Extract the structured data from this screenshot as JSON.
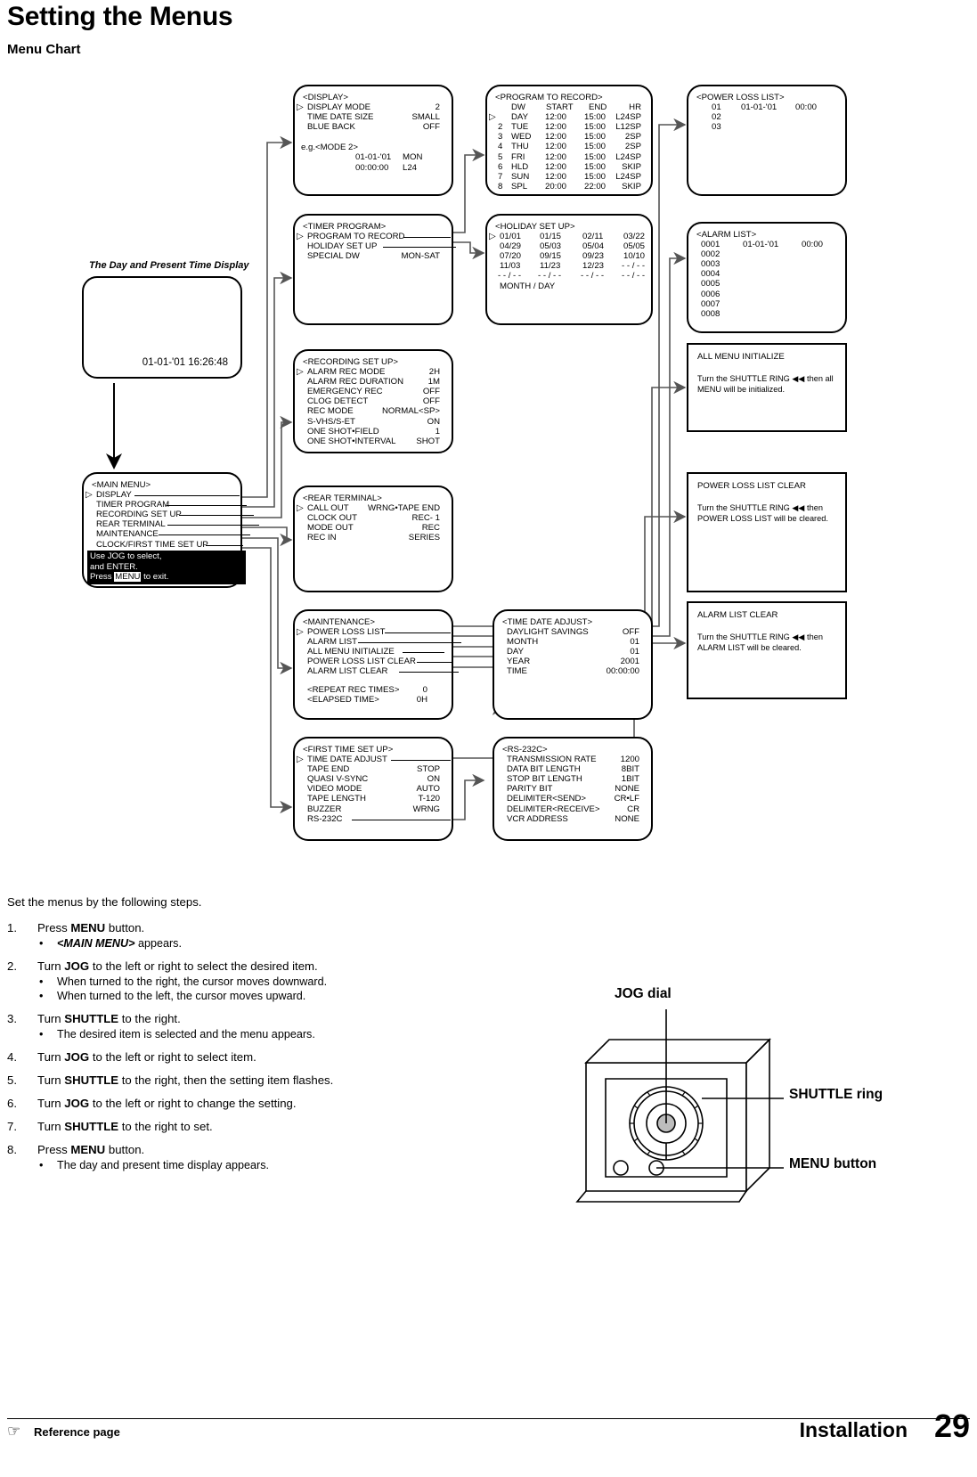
{
  "page": {
    "title": "Setting the Menus",
    "section": "Menu Chart",
    "footer_reference": "Reference page",
    "footer_section": "Installation",
    "footer_page_number": "29"
  },
  "daytime_display": {
    "caption": "The Day and Present Time Display",
    "stamp": "01-01-'01  16:26:48"
  },
  "boxes": {
    "display": {
      "title": "<DISPLAY>",
      "rows": [
        {
          "cursor": true,
          "label": "DISPLAY MODE",
          "value": "2"
        },
        {
          "cursor": false,
          "label": "TIME DATE SIZE",
          "value": "SMALL"
        },
        {
          "cursor": false,
          "label": "BLUE BACK",
          "value": "OFF"
        }
      ],
      "example_title": "e.g.<MODE 2>",
      "example_lines": [
        {
          "left": "01-01-'01",
          "right": "MON"
        },
        {
          "left": "00:00:00",
          "right": "L24"
        }
      ]
    },
    "program_to_record": {
      "title": "<PROGRAM TO RECORD>",
      "columns": [
        "DW",
        "START",
        "END",
        "HR"
      ],
      "rows": [
        {
          "no": "",
          "cursor": true,
          "dw": "DAY",
          "start": "12:00",
          "end": "15:00",
          "hr": "L24SP"
        },
        {
          "no": "2",
          "cursor": false,
          "dw": "TUE",
          "start": "12:00",
          "end": "15:00",
          "hr": "L12SP"
        },
        {
          "no": "3",
          "cursor": false,
          "dw": "WED",
          "start": "12:00",
          "end": "15:00",
          "hr": "2SP"
        },
        {
          "no": "4",
          "cursor": false,
          "dw": "THU",
          "start": "12:00",
          "end": "15:00",
          "hr": "2SP"
        },
        {
          "no": "5",
          "cursor": false,
          "dw": "FRI",
          "start": "12:00",
          "end": "15:00",
          "hr": "L24SP"
        },
        {
          "no": "6",
          "cursor": false,
          "dw": "HLD",
          "start": "12:00",
          "end": "15:00",
          "hr": "SKIP"
        },
        {
          "no": "7",
          "cursor": false,
          "dw": "SUN",
          "start": "12:00",
          "end": "15:00",
          "hr": "L24SP"
        },
        {
          "no": "8",
          "cursor": false,
          "dw": "SPL",
          "start": "20:00",
          "end": "22:00",
          "hr": "SKIP"
        }
      ]
    },
    "power_loss_list": {
      "title": "<POWER LOSS LIST>",
      "rows": [
        {
          "no": "01",
          "date": "01-01-'01",
          "time": "00:00"
        },
        {
          "no": "02",
          "date": "",
          "time": ""
        },
        {
          "no": "03",
          "date": "",
          "time": ""
        }
      ]
    },
    "timer_program": {
      "title": "<TIMER PROGRAM>",
      "rows": [
        {
          "cursor": true,
          "label": "PROGRAM TO RECORD",
          "value": "",
          "leader": true
        },
        {
          "cursor": false,
          "label": "HOLIDAY SET UP",
          "value": "",
          "leader": true
        },
        {
          "cursor": false,
          "label": "SPECIAL DW",
          "value": "MON-SAT",
          "leader": false
        }
      ]
    },
    "holiday_set_up": {
      "title": "<HOLIDAY SET UP>",
      "rows": [
        {
          "cursor": true,
          "cells": [
            "01/01",
            "01/15",
            "02/11",
            "03/22"
          ]
        },
        {
          "cursor": false,
          "cells": [
            "04/29",
            "05/03",
            "05/04",
            "05/05"
          ]
        },
        {
          "cursor": false,
          "cells": [
            "07/20",
            "09/15",
            "09/23",
            "10/10"
          ]
        },
        {
          "cursor": false,
          "cells": [
            "11/03",
            "11/23",
            "12/23",
            "- - / - -"
          ]
        },
        {
          "cursor": false,
          "cells": [
            "- - / - -",
            "- - / - -",
            "- - / - -",
            "- - / - -"
          ]
        }
      ],
      "footer": "MONTH / DAY"
    },
    "alarm_list": {
      "title": "<ALARM LIST>",
      "rows": [
        {
          "no": "0001",
          "date": "01-01-'01",
          "time": "00:00"
        },
        {
          "no": "0002",
          "date": "",
          "time": ""
        },
        {
          "no": "0003",
          "date": "",
          "time": ""
        },
        {
          "no": "0004",
          "date": "",
          "time": ""
        },
        {
          "no": "0005",
          "date": "",
          "time": ""
        },
        {
          "no": "0006",
          "date": "",
          "time": ""
        },
        {
          "no": "0007",
          "date": "",
          "time": ""
        },
        {
          "no": "0008",
          "date": "",
          "time": ""
        }
      ]
    },
    "recording_set_up": {
      "title": "<RECORDING SET UP>",
      "rows": [
        {
          "cursor": true,
          "label": "ALARM REC MODE",
          "value": "2H"
        },
        {
          "cursor": false,
          "label": "ALARM REC DURATION",
          "value": "1M"
        },
        {
          "cursor": false,
          "label": "EMERGENCY REC",
          "value": "OFF"
        },
        {
          "cursor": false,
          "label": "CLOG DETECT",
          "value": "OFF"
        },
        {
          "cursor": false,
          "label": "REC MODE",
          "value": "NORMAL<SP>"
        },
        {
          "cursor": false,
          "label": "S-VHS/S-ET",
          "value": "ON"
        },
        {
          "cursor": false,
          "label": "ONE SHOT•FIELD",
          "value": "1"
        },
        {
          "cursor": false,
          "label": "ONE SHOT•INTERVAL",
          "value": "SHOT"
        }
      ]
    },
    "all_menu_initialize": {
      "title": "ALL MENU INITIALIZE",
      "body": "Turn the SHUTTLE RING ◀◀ then all MENU will be initialized."
    },
    "main_menu": {
      "title": "<MAIN MENU>",
      "rows": [
        {
          "cursor": true,
          "label": "DISPLAY"
        },
        {
          "cursor": false,
          "label": "TIMER PROGRAM"
        },
        {
          "cursor": false,
          "label": "RECORDING SET UP"
        },
        {
          "cursor": false,
          "label": "REAR TERMINAL"
        },
        {
          "cursor": false,
          "label": "MAINTENANCE"
        },
        {
          "cursor": false,
          "label": "CLOCK/FIRST TIME SET UP"
        }
      ],
      "help_line1": "Use JOG to select,",
      "help_line2": "and ENTER.",
      "help_line3_pre": "Press ",
      "help_line3_key": "MENU",
      "help_line3_post": " to exit."
    },
    "rear_terminal": {
      "title": "<REAR TERMINAL>",
      "rows": [
        {
          "cursor": true,
          "label": "CALL OUT",
          "value": "WRNG•TAPE END"
        },
        {
          "cursor": false,
          "label": "CLOCK OUT",
          "value": "REC- 1"
        },
        {
          "cursor": false,
          "label": "MODE OUT",
          "value": "REC"
        },
        {
          "cursor": false,
          "label": "REC IN",
          "value": "SERIES"
        }
      ]
    },
    "power_loss_list_clear": {
      "title": "POWER LOSS LIST CLEAR",
      "body": "Turn the SHUTTLE RING ◀◀ then POWER LOSS LIST will be cleared."
    },
    "maintenance": {
      "title": "<MAINTENANCE>",
      "rows": [
        {
          "cursor": true,
          "label": "POWER LOSS LIST"
        },
        {
          "cursor": false,
          "label": "ALARM LIST"
        },
        {
          "cursor": false,
          "label": "ALL MENU INITIALIZE"
        },
        {
          "cursor": false,
          "label": "POWER LOSS LIST CLEAR"
        },
        {
          "cursor": false,
          "label": "ALARM LIST CLEAR"
        }
      ],
      "extra": [
        {
          "label": "<REPEAT REC TIMES>",
          "value": "0"
        },
        {
          "label": "<ELAPSED TIME>",
          "value": "0H"
        }
      ]
    },
    "time_date_adjust": {
      "title": "<TIME DATE ADJUST>",
      "rows": [
        {
          "cursor": false,
          "label": "DAYLIGHT SAVINGS",
          "value": "OFF"
        },
        {
          "cursor": false,
          "label": "MONTH",
          "value": "01"
        },
        {
          "cursor": false,
          "label": "DAY",
          "value": "01"
        },
        {
          "cursor": false,
          "label": "YEAR",
          "value": "2001"
        },
        {
          "cursor": false,
          "label": "TIME",
          "value": "00:00:00"
        }
      ]
    },
    "alarm_list_clear": {
      "title": "ALARM LIST CLEAR",
      "body": "Turn the SHUTTLE RING ◀◀ then ALARM LIST will be cleared."
    },
    "first_time_set_up": {
      "title": "<FIRST TIME SET UP>",
      "rows": [
        {
          "cursor": true,
          "label": "TIME DATE ADJUST",
          "value": "",
          "leader": true
        },
        {
          "cursor": false,
          "label": "TAPE END",
          "value": "STOP",
          "leader": false
        },
        {
          "cursor": false,
          "label": "QUASI V-SYNC",
          "value": "ON",
          "leader": false
        },
        {
          "cursor": false,
          "label": "VIDEO MODE",
          "value": "AUTO",
          "leader": false
        },
        {
          "cursor": false,
          "label": "TAPE LENGTH",
          "value": "T-120",
          "leader": false
        },
        {
          "cursor": false,
          "label": "BUZZER",
          "value": "WRNG",
          "leader": false
        },
        {
          "cursor": false,
          "label": "RS-232C",
          "value": "",
          "leader": true
        }
      ]
    },
    "rs232c": {
      "title": "<RS-232C>",
      "rows": [
        {
          "label": "TRANSMISSION RATE",
          "value": "1200"
        },
        {
          "label": "DATA BIT LENGTH",
          "value": "8BIT"
        },
        {
          "label": "STOP BIT LENGTH",
          "value": "1BIT"
        },
        {
          "label": "PARITY BIT",
          "value": "NONE"
        },
        {
          "label": "DELIMITER<SEND>",
          "value": "CR•LF"
        },
        {
          "label": "DELIMITER<RECEIVE>",
          "value": "CR"
        },
        {
          "label": "VCR ADDRESS",
          "value": "NONE"
        }
      ]
    }
  },
  "instructions": {
    "lead": "Set the menus by the following steps.",
    "steps": [
      {
        "num": "1.",
        "head_pre": "Press ",
        "head_bold": "MENU",
        "head_post": " button.",
        "bullets": [
          {
            "bold_italic": "<MAIN MENU>",
            "text": " appears."
          }
        ]
      },
      {
        "num": "2.",
        "head_pre": "Turn ",
        "head_bold": "JOG",
        "head_post": " to the left or right to select the desired item.",
        "bullets": [
          {
            "bold_italic": "",
            "text": "When turned to the right, the cursor moves downward."
          },
          {
            "bold_italic": "",
            "text": "When turned to the left, the cursor moves upward."
          }
        ]
      },
      {
        "num": "3.",
        "head_pre": "Turn ",
        "head_bold": "SHUTTLE",
        "head_post": " to the right.",
        "bullets": [
          {
            "bold_italic": "",
            "text": "The desired item is selected and the menu appears."
          }
        ]
      },
      {
        "num": "4.",
        "head_pre": "Turn ",
        "head_bold": "JOG",
        "head_post": " to the left or right to select item.",
        "bullets": []
      },
      {
        "num": "5.",
        "head_pre": "Turn ",
        "head_bold": "SHUTTLE",
        "head_post": " to the right, then the setting item flashes.",
        "bullets": []
      },
      {
        "num": "6.",
        "head_pre": "Turn ",
        "head_bold": "JOG",
        "head_post": " to the left or right to change the setting.",
        "bullets": []
      },
      {
        "num": "7.",
        "head_pre": "Turn ",
        "head_bold": "SHUTTLE",
        "head_post": " to the right to set.",
        "bullets": []
      },
      {
        "num": "8.",
        "head_pre": "Press ",
        "head_bold": "MENU",
        "head_post": " button.",
        "bullets": [
          {
            "bold_italic": "",
            "text": "The day and present time display appears."
          }
        ]
      }
    ]
  },
  "device": {
    "jog_label": "JOG dial",
    "shuttle_label": "SHUTTLE ring",
    "menu_label": "MENU button"
  },
  "colors": {
    "ink": "#000000",
    "paper": "#ffffff",
    "wire": "#555555"
  }
}
